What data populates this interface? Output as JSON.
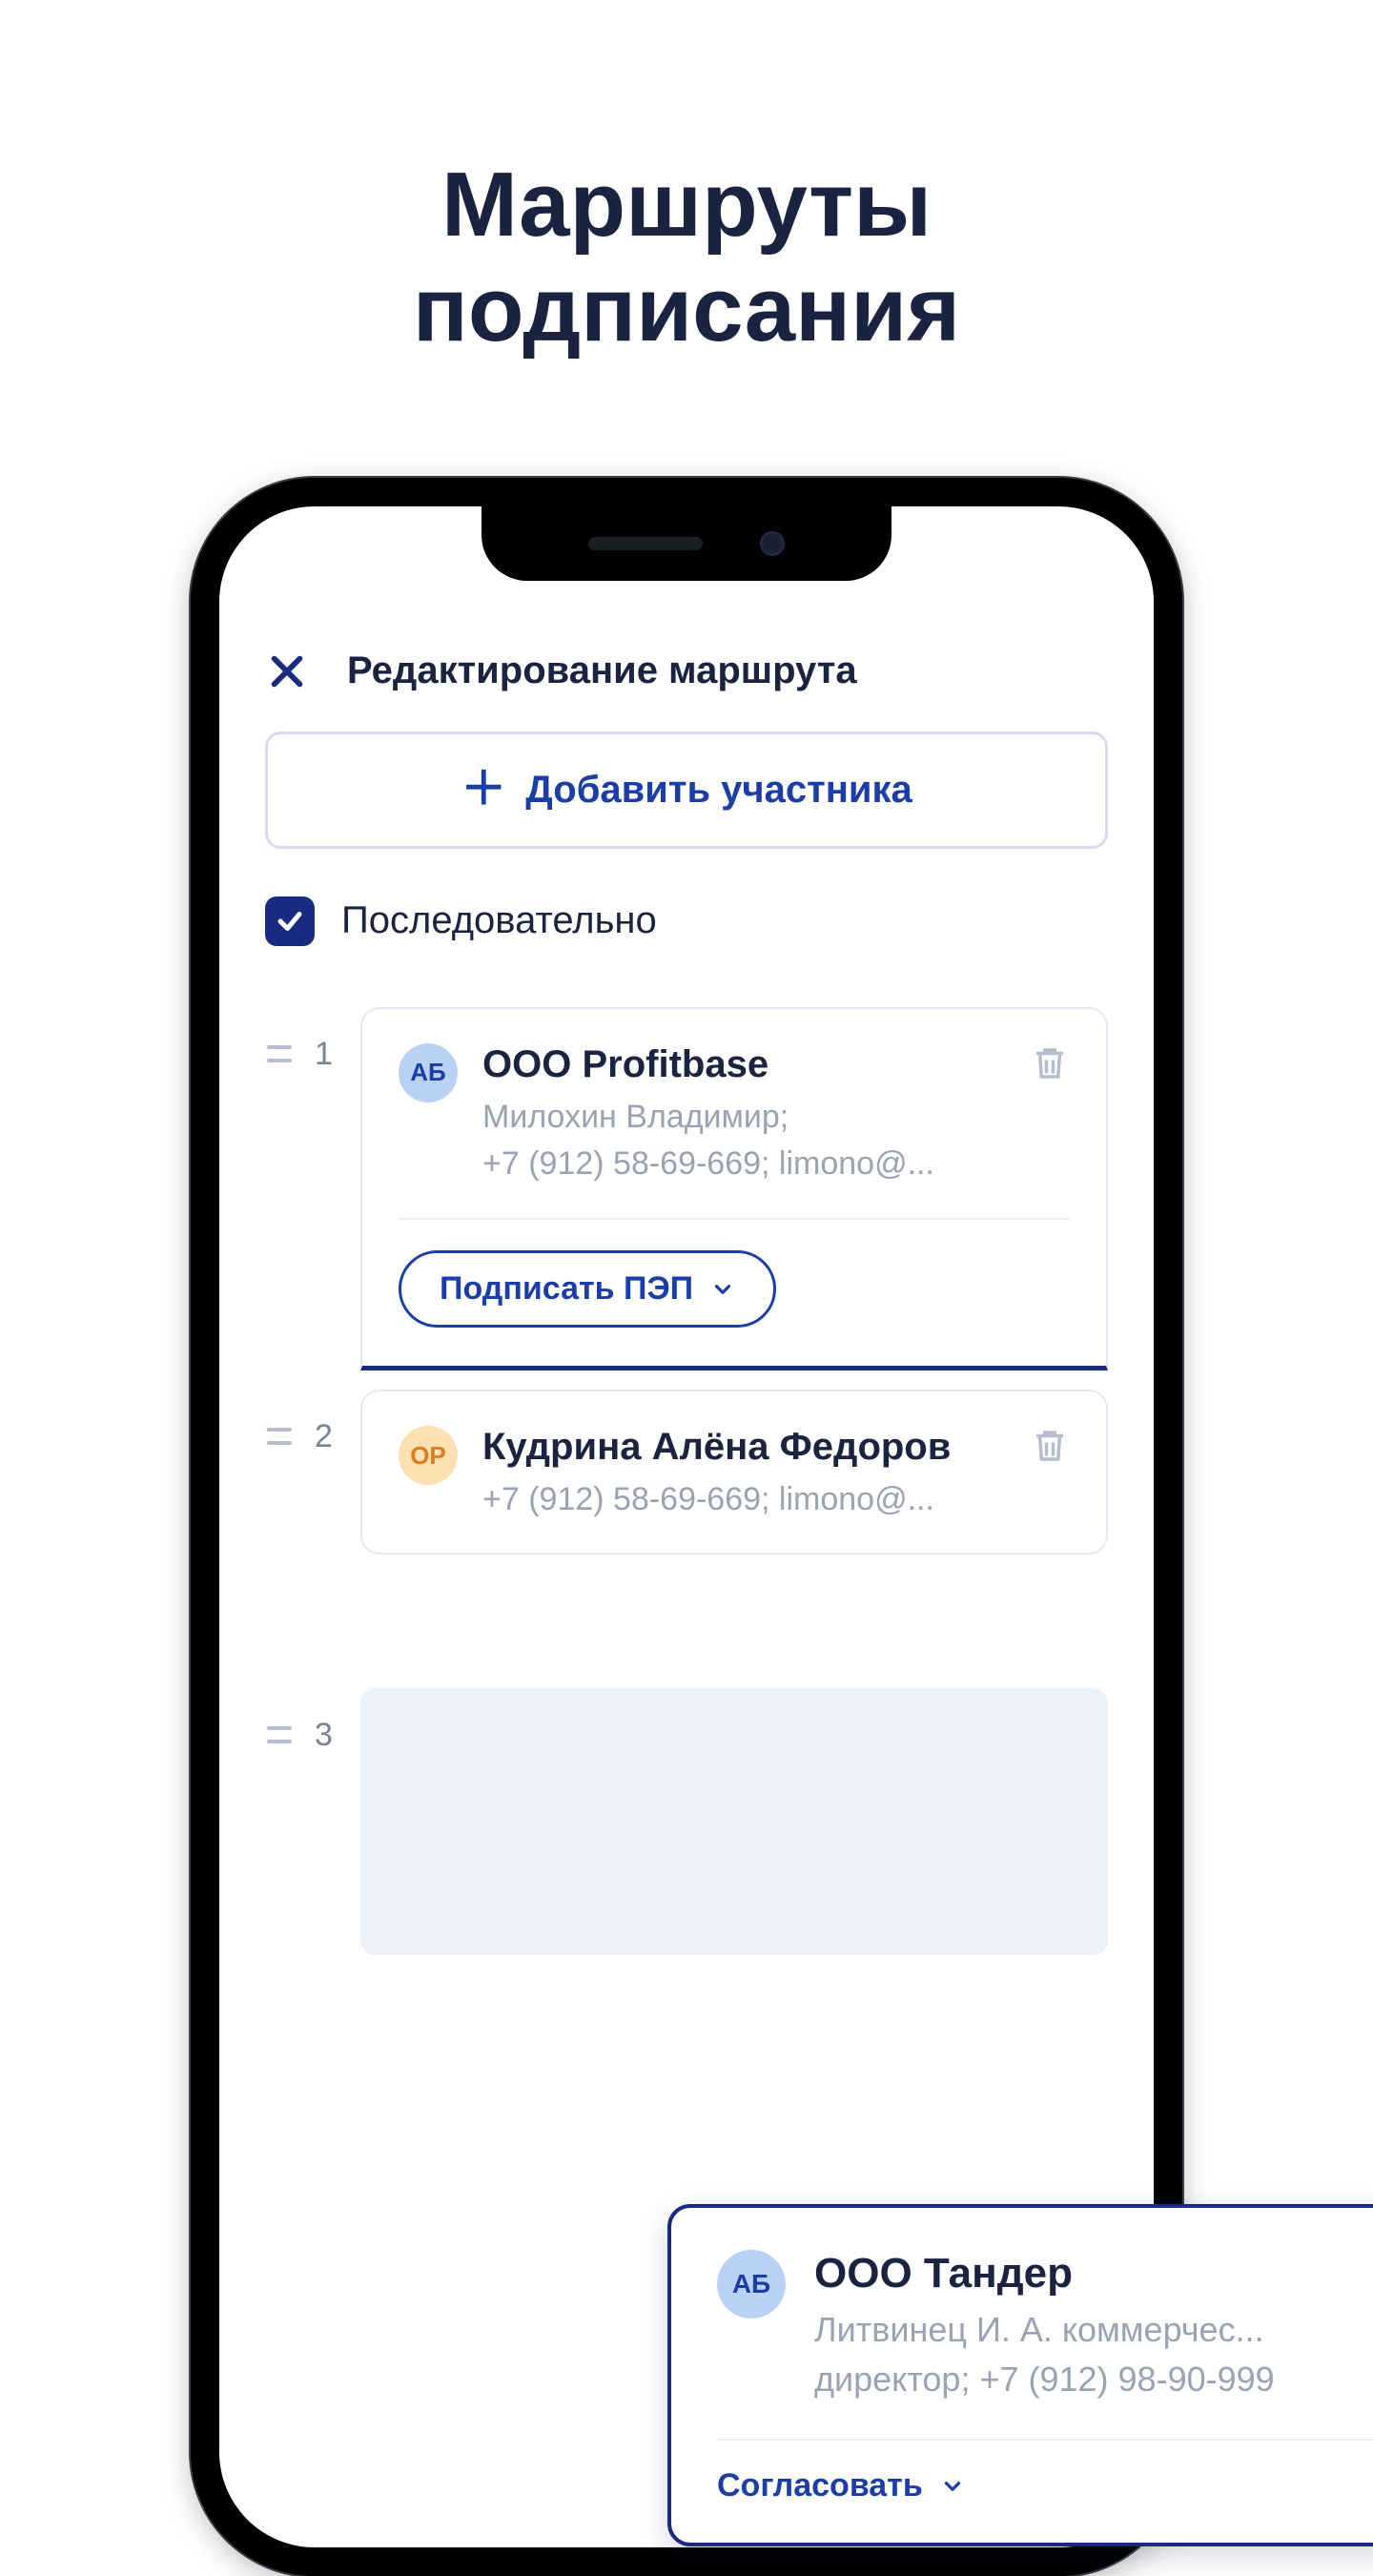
{
  "headline_line1": "Маршруты",
  "headline_line2": "подписания",
  "nav_title": "Редактирование маршрута",
  "add_label": "Добавить участника",
  "sequential_label": "Последовательно",
  "participants": [
    {
      "index": "1",
      "avatar": "АБ",
      "avatar_color": "blue",
      "title": "OOO Profitbase",
      "sub": "Милохин Владимир;\n+7 (912) 58-69-669; limono@...",
      "sign_label": "Подписать ПЭП"
    },
    {
      "index": "2",
      "avatar": "ОР",
      "avatar_color": "orange",
      "title": "Кудрина Алёна Федоров",
      "sub": "+7 (912) 58-69-669; limono@..."
    }
  ],
  "placeholder_index": "3",
  "floating": {
    "avatar": "АБ",
    "title": "ООО Тандер",
    "sub": "Литвинец И. А. коммерчес...\nдиректор; +7 (912) 98-90-999",
    "action_label": "Согласовать"
  }
}
